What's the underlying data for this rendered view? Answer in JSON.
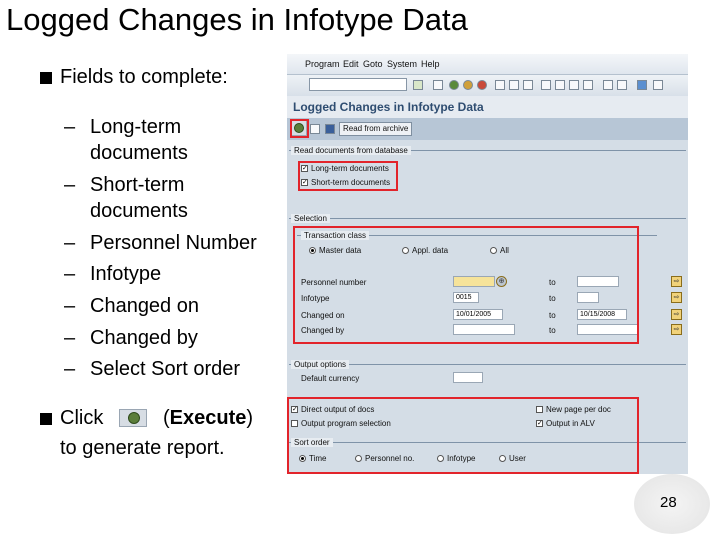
{
  "slide": {
    "title": "Logged Changes in Infotype Data",
    "bullet1": "Fields to complete:",
    "sub_items": [
      "Long-term documents",
      "Short-term documents",
      "Personnel Number",
      "Infotype",
      "Changed on",
      "Changed by",
      "Select Sort order"
    ],
    "click_text": "Click",
    "execute_label": "Execute",
    "bullet2_line2": "to generate report.",
    "page_number": "28"
  },
  "sap": {
    "menu": [
      "Program",
      "Edit",
      "Goto",
      "System",
      "Help"
    ],
    "title": "Logged Changes in Infotype Data",
    "archive_button": "Read from archive",
    "read_docs_group": "Read documents from database",
    "long_term_label": "Long-term documents",
    "short_term_label": "Short-term documents",
    "selection_group": "Selection",
    "transaction_class_group": "Transaction class",
    "master_data": "Master data",
    "applicant_data": "Appl. data",
    "all": "All",
    "fields": {
      "personnel_number": "Personnel number",
      "infotype": "Infotype",
      "changed_on": "Changed on",
      "changed_by": "Changed by",
      "to": "to",
      "infotype_value": "0015",
      "changed_on_from": "10/01/2005",
      "changed_on_to": "10/15/2008"
    },
    "output_group": "Output options",
    "default_currency": "Default currency",
    "direct_output": "Direct output of docs",
    "output_long": "Output program selection",
    "new_page": "New page per doc",
    "output_alv": "Output in ALV",
    "sort_group": "Sort order",
    "sort_options": [
      "Time",
      "Personnel no.",
      "Infotype",
      "User"
    ]
  }
}
